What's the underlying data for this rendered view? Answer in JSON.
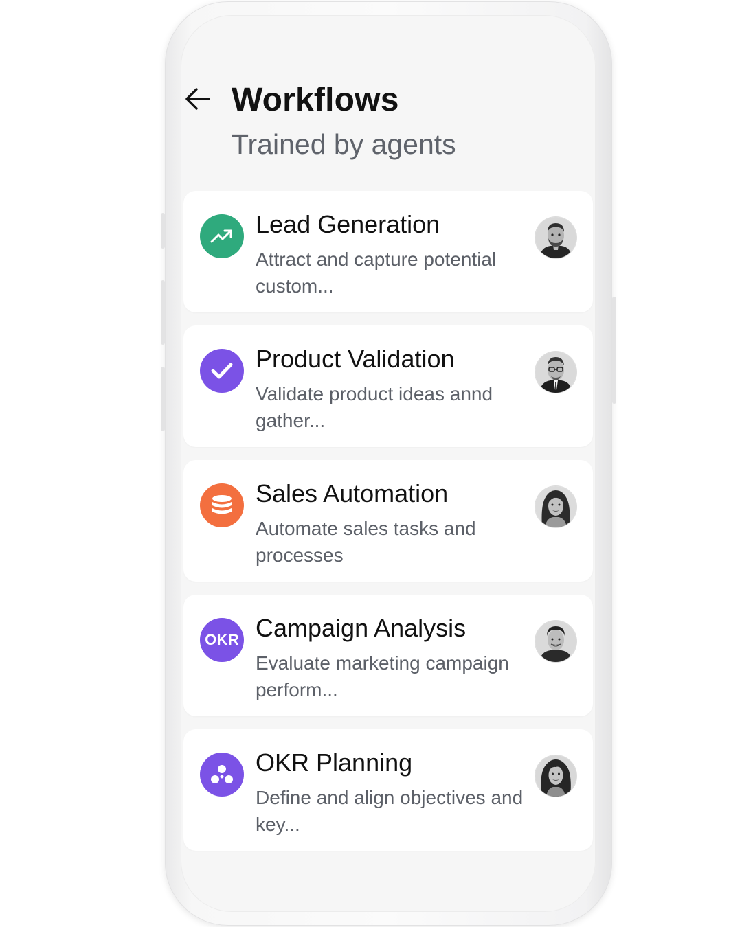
{
  "header": {
    "title": "Workflows",
    "subtitle": "Trained by agents"
  },
  "colors": {
    "lead": "#2faa7d",
    "validation": "#7b52e6",
    "sales": "#f36f3f",
    "campaign": "#7b52e6",
    "okr": "#7b52e6"
  },
  "workflows": [
    {
      "title": "Lead Generation",
      "description": "Attract and capture potential custom...",
      "icon": "trending-up-icon",
      "avatar": "man-beard-avatar"
    },
    {
      "title": "Product Validation",
      "description": "Validate product ideas annd gather...",
      "icon": "checkmark-icon",
      "avatar": "man-glasses-avatar"
    },
    {
      "title": "Sales Automation",
      "description": "Automate sales tasks and processes",
      "icon": "database-icon",
      "avatar": "woman-avatar"
    },
    {
      "title": "Campaign Analysis",
      "description": "Evaluate marketing campaign perform...",
      "icon": "okr-badge-icon",
      "icon_text": "OKR",
      "avatar": "man-smiling-avatar"
    },
    {
      "title": "OKR Planning",
      "description": "Define and align objectives and key...",
      "icon": "cluster-icon",
      "avatar": "woman-long-hair-avatar"
    }
  ]
}
